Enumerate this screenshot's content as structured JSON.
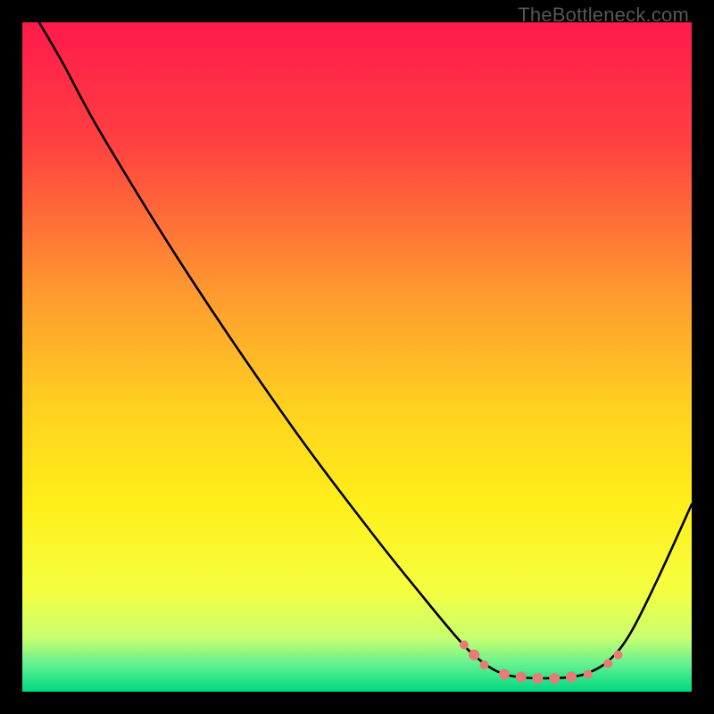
{
  "watermark": "TheBottleneck.com",
  "chart_data": {
    "type": "line",
    "title": "",
    "xlabel": "",
    "ylabel": "",
    "xlim": [
      0,
      100
    ],
    "ylim": [
      0,
      100
    ],
    "background_gradient": {
      "stops": [
        {
          "offset": 0,
          "color": "#ff1a4b"
        },
        {
          "offset": 18,
          "color": "#ff4040"
        },
        {
          "offset": 40,
          "color": "#ff9830"
        },
        {
          "offset": 58,
          "color": "#ffd21f"
        },
        {
          "offset": 72,
          "color": "#ffef1a"
        },
        {
          "offset": 85,
          "color": "#f4ff40"
        },
        {
          "offset": 92,
          "color": "#c8ff70"
        },
        {
          "offset": 96,
          "color": "#60f090"
        },
        {
          "offset": 100,
          "color": "#00d880"
        }
      ]
    },
    "series": [
      {
        "name": "bottleneck-curve",
        "color": "#000000",
        "points": [
          {
            "x": 2.5,
            "y": 100
          },
          {
            "x": 6,
            "y": 94
          },
          {
            "x": 12,
            "y": 83
          },
          {
            "x": 25,
            "y": 62
          },
          {
            "x": 40,
            "y": 40
          },
          {
            "x": 52,
            "y": 24
          },
          {
            "x": 60,
            "y": 14
          },
          {
            "x": 65,
            "y": 8
          },
          {
            "x": 68,
            "y": 5
          },
          {
            "x": 71,
            "y": 3
          },
          {
            "x": 74,
            "y": 2.2
          },
          {
            "x": 78,
            "y": 2
          },
          {
            "x": 82,
            "y": 2.2
          },
          {
            "x": 85,
            "y": 3
          },
          {
            "x": 88,
            "y": 5
          },
          {
            "x": 91,
            "y": 9
          },
          {
            "x": 95,
            "y": 17
          },
          {
            "x": 100,
            "y": 28
          }
        ]
      }
    ],
    "markers": {
      "color": "#e87b77",
      "points": [
        {
          "x": 66,
          "y": 7,
          "r": 5
        },
        {
          "x": 67.5,
          "y": 5.5,
          "r": 6
        },
        {
          "x": 69,
          "y": 4,
          "r": 5
        },
        {
          "x": 72,
          "y": 2.6,
          "r": 6
        },
        {
          "x": 74.5,
          "y": 2.2,
          "r": 6
        },
        {
          "x": 77,
          "y": 2.0,
          "r": 6
        },
        {
          "x": 79.5,
          "y": 2.0,
          "r": 6
        },
        {
          "x": 82,
          "y": 2.2,
          "r": 6
        },
        {
          "x": 84.5,
          "y": 2.6,
          "r": 5
        },
        {
          "x": 87.5,
          "y": 4.2,
          "r": 5
        },
        {
          "x": 89,
          "y": 5.5,
          "r": 5
        }
      ]
    }
  }
}
